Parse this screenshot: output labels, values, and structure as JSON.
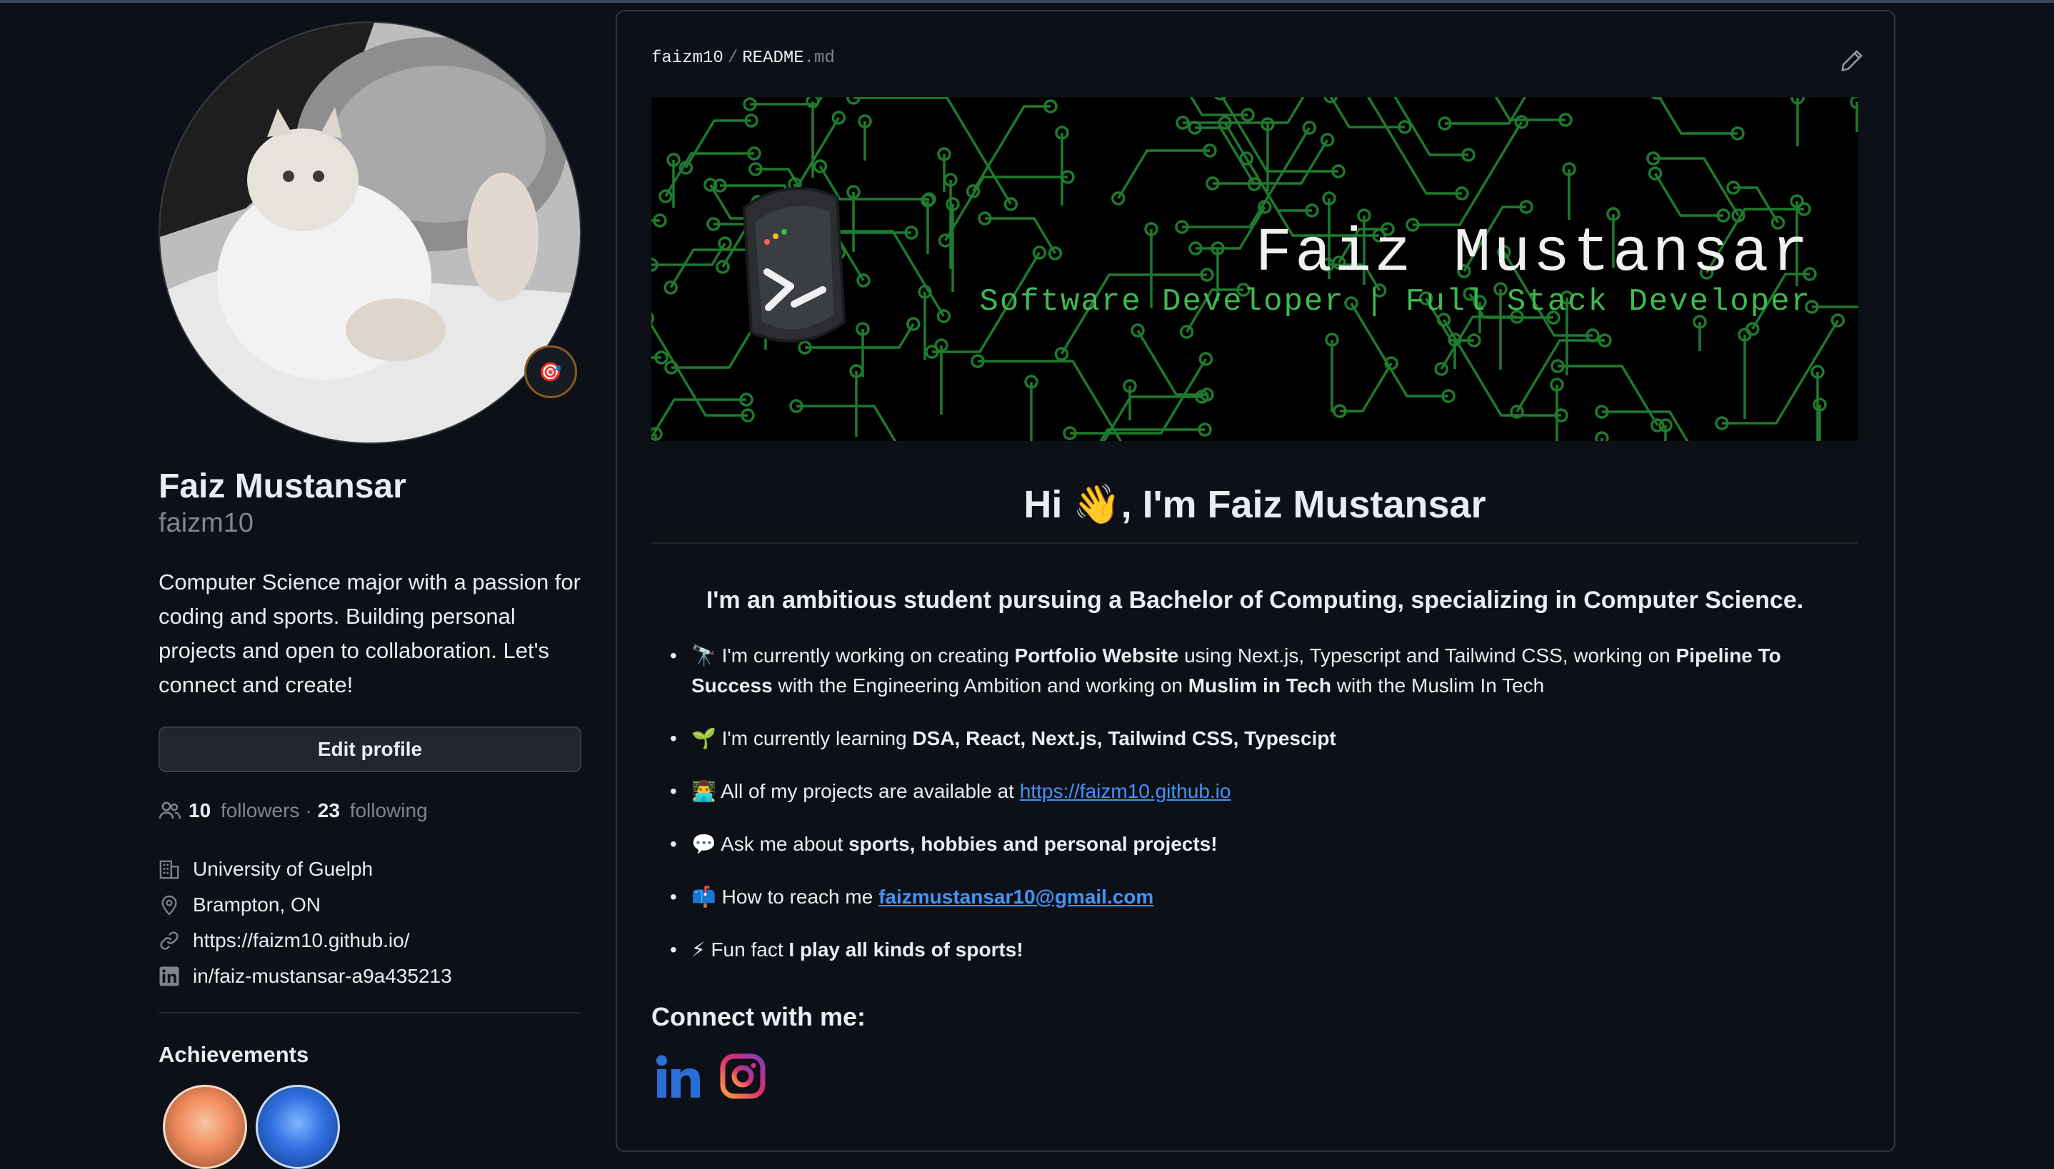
{
  "profile": {
    "name": "Faiz Mustansar",
    "login": "faizm10",
    "status_emoji": "🎯",
    "bio": "Computer Science major with a passion for coding and sports. Building personal projects and open to collaboration. Let's connect and create!",
    "edit_label": "Edit profile",
    "followers_count": "10",
    "followers_label": "followers",
    "following_count": "23",
    "following_label": "following",
    "details": [
      {
        "icon": "organization-icon",
        "text": "University of Guelph"
      },
      {
        "icon": "location-icon",
        "text": "Brampton, ON"
      },
      {
        "icon": "link-icon",
        "text": "https://faizm10.github.io/"
      },
      {
        "icon": "linkedin-icon",
        "text": "in/faiz-mustansar-a9a435213"
      }
    ],
    "achievements_title": "Achievements"
  },
  "readme": {
    "owner": "faizm10",
    "file": "README",
    "ext": ".md",
    "banner_name": "Faiz Mustansar",
    "banner_subtitle": "Software Developer | Full Stack Developer",
    "greeting": "Hi 👋, I'm Faiz Mustansar",
    "intro": "I'm an ambitious student pursuing a Bachelor of Computing, specializing in Computer Science.",
    "bullets": {
      "b1_emoji": "🔭",
      "b1_pre": " I'm currently working on creating ",
      "b1_bold1": "Portfolio Website",
      "b1_mid1": " using Next.js, Typescript and Tailwind CSS, working on ",
      "b1_bold2": "Pipeline To Success",
      "b1_mid2": " with the Engineering Ambition and working on ",
      "b1_bold3": "Muslim in Tech",
      "b1_post": " with the Muslim In Tech",
      "b2_emoji": "🌱",
      "b2_pre": " I'm currently learning ",
      "b2_bold": "DSA, React, Next.js, Tailwind CSS, Typescipt",
      "b3_emoji": "👨‍💻",
      "b3_pre": " All of my projects are available at ",
      "b3_link": "https://faizm10.github.io",
      "b4_emoji": "💬",
      "b4_pre": " Ask me about ",
      "b4_bold": "sports, hobbies and personal projects!",
      "b5_emoji": "📫",
      "b5_pre": " How to reach me ",
      "b5_link": "faizmustansar10@gmail.com",
      "b6_emoji": "⚡",
      "b6_pre": " Fun fact ",
      "b6_bold": "I play all kinds of sports!"
    },
    "connect_title": "Connect with me:"
  },
  "colors": {
    "background": "#0d1117",
    "link": "#4493f8",
    "banner_green": "#3fb950",
    "muted": "#7d8590"
  }
}
